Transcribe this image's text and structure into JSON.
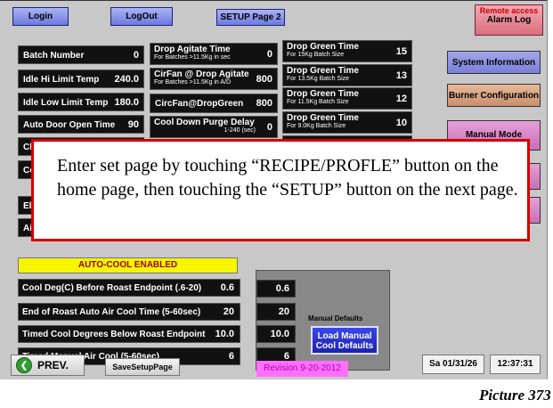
{
  "header": {
    "login_label": "Login",
    "logout_label": "LogOut",
    "setup_page_label": "SETUP Page 2",
    "remote_access_label": "Remote access",
    "alarm_log_label": "Alarm Log"
  },
  "left_params": [
    {
      "label": "Batch Number",
      "value": "0"
    },
    {
      "label": "Idle Hi Limit Temp",
      "value": "240.0"
    },
    {
      "label": "Idle Low Limit Temp",
      "value": "180.0"
    },
    {
      "label": "Auto Door Open Time",
      "value": "90"
    },
    {
      "label": "Ch",
      "value": ""
    },
    {
      "label": "Co",
      "value": ""
    },
    {
      "label": "Ele",
      "value": ""
    },
    {
      "label": "Air",
      "value": ""
    }
  ],
  "middle_params": [
    {
      "label": "Drop Agitate Time",
      "sub": "For Batches >11.5Kg in sec",
      "value": "0"
    },
    {
      "label": "CirFan @ Drop Agitate",
      "sub": "For Batches >11.5Kg in A/D",
      "value": "800"
    },
    {
      "label": "CircFan@DropGreen",
      "sub": "",
      "value": "800"
    },
    {
      "label": "Cool Down Purge Delay",
      "sub": "1-240 (sec)",
      "value": "0"
    }
  ],
  "right_params": [
    {
      "label": "Drop Green Time",
      "sub": "For 15Kg Batch Size",
      "value": "15"
    },
    {
      "label": "Drop Green Time",
      "sub": "For 13.5Kg Batch Size",
      "value": "13"
    },
    {
      "label": "Drop Green Time",
      "sub": "For 11.5Kg Batch Size",
      "value": "12"
    },
    {
      "label": "Drop Green Time",
      "sub": "For 9.0Kg Batch Size",
      "value": "10"
    }
  ],
  "side_buttons": {
    "system_information": "System Information",
    "burner_configuration": "Burner Configuration",
    "manual_mode": "Manual Mode"
  },
  "overlay_text": "Enter set page by touching “RECIPE/PROFLE” button on the home page, then touching the “SETUP” button on the next page.",
  "autocool_label": "AUTO-COOL ENABLED",
  "cool_params": [
    {
      "label": "Cool Deg(C) Before Roast Endpoint (.6-20)",
      "value": "0.6"
    },
    {
      "label": "End of Roast Auto Air Cool Time (5-60sec)",
      "value": "20"
    },
    {
      "label": "Timed Cool Degrees Below Roast Endpoint",
      "value": "10.0"
    },
    {
      "label": "Timed Manual Air Cool (5-60sec)",
      "value": "6"
    }
  ],
  "manual_defaults": {
    "values": [
      "0.6",
      "20",
      "10.0",
      "6"
    ],
    "label": "Manual Defaults",
    "load_button": "Load Manual Cool Defaults"
  },
  "footer": {
    "prev_label": "PREV.",
    "save_label": "SaveSetupPage",
    "revision": "Revision 9-20-2012",
    "date": "Sa 01/31/26",
    "time": "12:37:31",
    "page_number": "Picture 373"
  }
}
